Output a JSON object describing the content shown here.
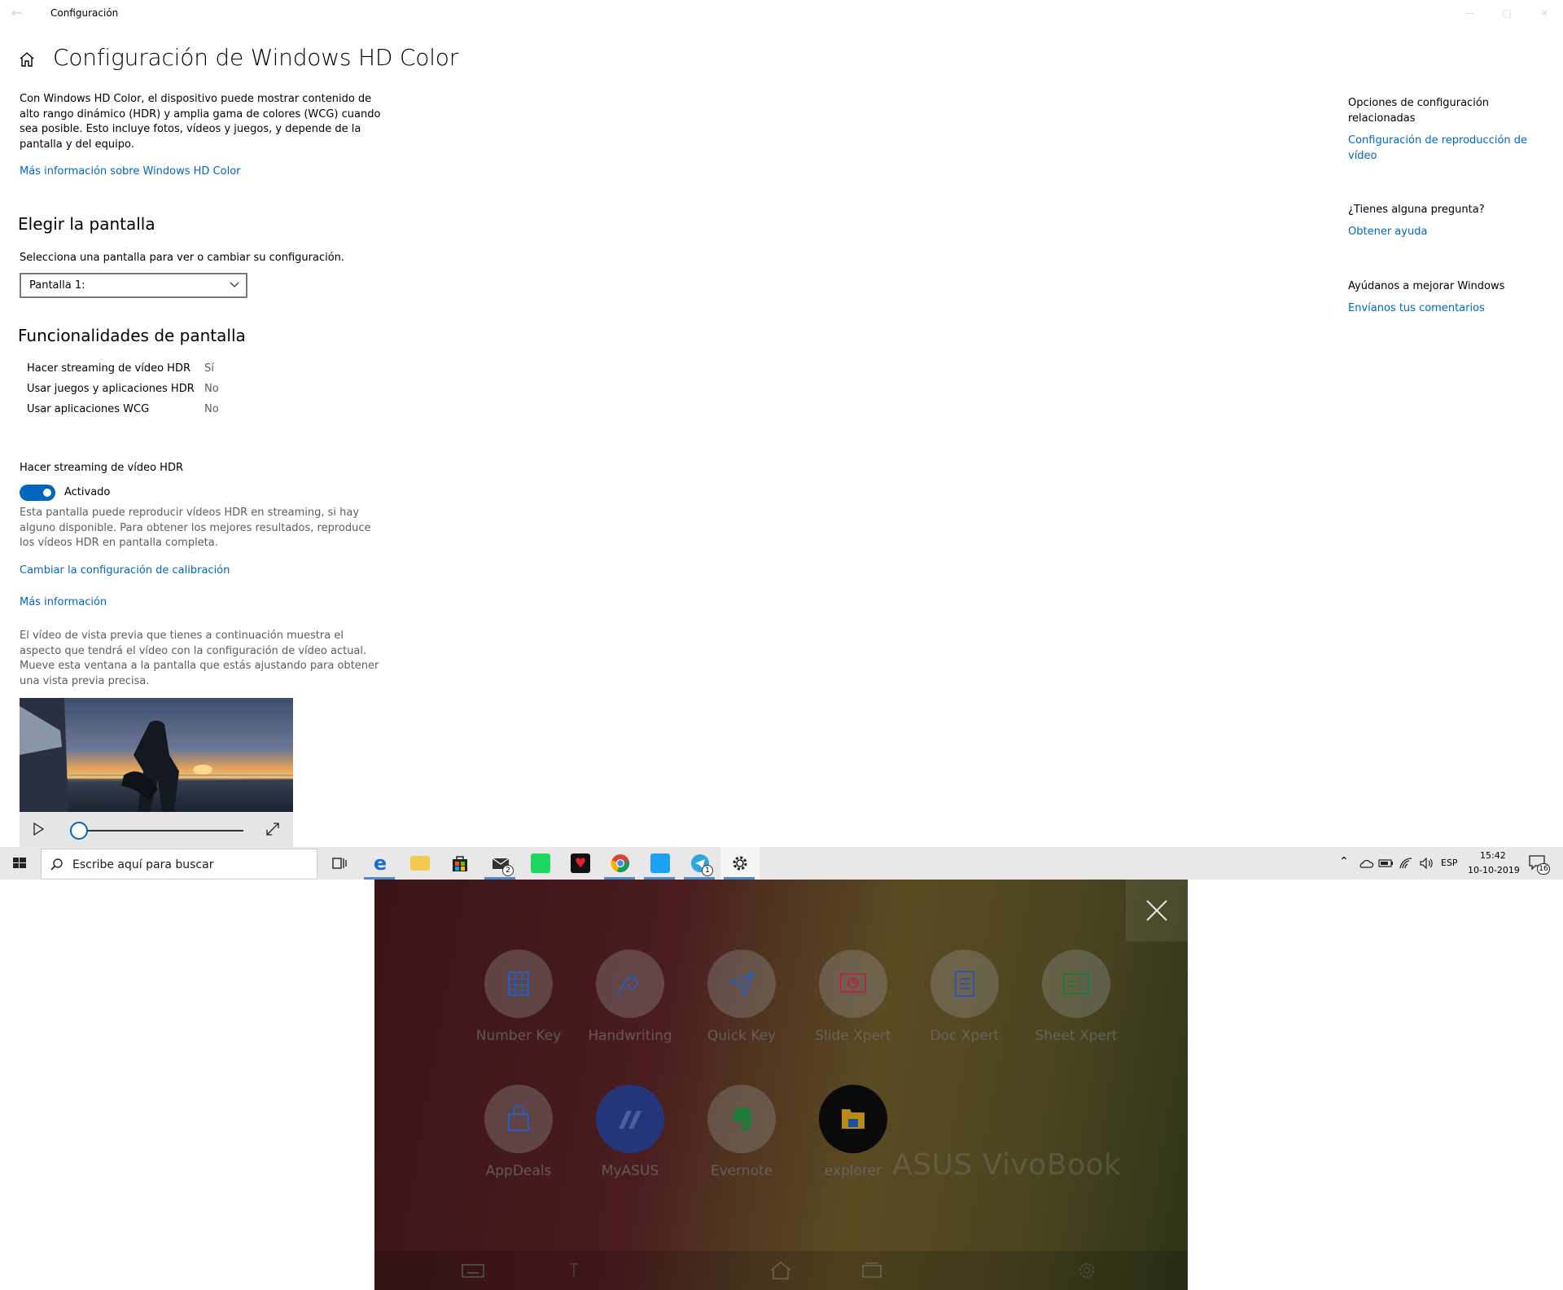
{
  "window": {
    "app_title": "Configuración",
    "page_title": "Configuración de Windows HD Color"
  },
  "intro": {
    "description": "Con Windows HD Color, el dispositivo puede mostrar contenido de alto rango dinámico (HDR) y amplia gama de colores (WCG) cuando sea posible. Esto incluye fotos, vídeos y juegos, y depende de la pantalla y del equipo.",
    "learn_more_link": "Más información sobre Windows HD Color"
  },
  "display_choice": {
    "heading": "Elegir la pantalla",
    "instruction": "Selecciona una pantalla para ver o cambiar su configuración.",
    "selected": "Pantalla 1:"
  },
  "capabilities": {
    "heading": "Funcionalidades de pantalla",
    "rows": [
      {
        "label": "Hacer streaming de vídeo HDR",
        "value": "Sí"
      },
      {
        "label": "Usar juegos y aplicaciones HDR",
        "value": "No"
      },
      {
        "label": "Usar aplicaciones WCG",
        "value": "No"
      }
    ]
  },
  "hdr_streaming": {
    "label": "Hacer streaming de vídeo HDR",
    "toggle_state": "Activado",
    "description": "Esta pantalla puede reproducir vídeos HDR en streaming, si hay alguno disponible. Para obtener los mejores resultados, reproduce los vídeos HDR en pantalla completa.",
    "calibration_link": "Cambiar la configuración de calibración",
    "more_info_link": "Más información",
    "preview_description": "El vídeo de vista previa que tienes a continuación muestra el aspecto que tendrá el vídeo con la configuración de vídeo actual. Mueve esta ventana a la pantalla que estás ajustando para obtener una vista previa precisa."
  },
  "sidebar": {
    "related_heading": "Opciones de configuración relacionadas",
    "related_link": "Configuración de reproducción de vídeo",
    "question_heading": "¿Tienes alguna pregunta?",
    "question_link": "Obtener ayuda",
    "feedback_heading": "Ayúdanos a mejorar Windows",
    "feedback_link": "Envíanos tus comentarios"
  },
  "taskbar": {
    "search_placeholder": "Escribe aquí para buscar",
    "mail_badge": "2",
    "telegram_badge": "1",
    "language": "ESP",
    "time": "15:42",
    "date": "10-10-2019",
    "notifications": "16"
  },
  "asus_panel": {
    "apps": [
      {
        "label": "Number Key",
        "icon": "number-key-icon"
      },
      {
        "label": "Handwriting",
        "icon": "handwriting-icon"
      },
      {
        "label": "Quick Key",
        "icon": "quick-key-icon"
      },
      {
        "label": "Slide Xpert",
        "icon": "slide-xpert-icon"
      },
      {
        "label": "Doc Xpert",
        "icon": "doc-xpert-icon"
      },
      {
        "label": "Sheet Xpert",
        "icon": "sheet-xpert-icon"
      },
      {
        "label": "AppDeals",
        "icon": "appdeals-icon"
      },
      {
        "label": "MyASUS",
        "icon": "myasus-icon"
      },
      {
        "label": "Evernote",
        "icon": "evernote-icon"
      },
      {
        "label": "explorer",
        "icon": "explorer-icon"
      }
    ],
    "brand": "ASUS VivoBook"
  },
  "colors": {
    "accent": "#0067c0",
    "taskbar": "#e9e7e8"
  }
}
